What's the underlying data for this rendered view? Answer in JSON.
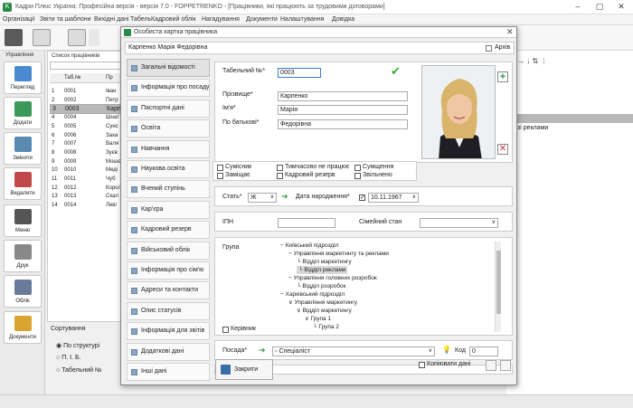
{
  "app": {
    "title": "Кадри Плюс Україна: Професійна версія - версія 7.0 - FOPPETRENKO - [Працівники, які працюють за трудовими договорами]",
    "menu": [
      "Організації",
      "Звіти та шаблони",
      "Вихідні дані",
      "Табель",
      "Кадровий облік",
      "Нагадування",
      "Документи",
      "Налаштування",
      "Довідка"
    ]
  },
  "left_panel": {
    "title": "Управління",
    "buttons": [
      "Перегляд",
      "Додати",
      "Змінити",
      "Видалити",
      "Меню",
      "Друк",
      "Облік",
      "Документи"
    ]
  },
  "list_panel": {
    "title": "Список працівників",
    "column_tab": "Таб.№",
    "column_name": "Пр",
    "rows": [
      {
        "n": "1",
        "tab": "0001",
        "name": "Іван"
      },
      {
        "n": "2",
        "tab": "0002",
        "name": "Петр"
      },
      {
        "n": "3",
        "tab": "0003",
        "name": "Карп"
      },
      {
        "n": "4",
        "tab": "0004",
        "name": "Шнат"
      },
      {
        "n": "5",
        "tab": "0005",
        "name": "Сунс"
      },
      {
        "n": "6",
        "tab": "0006",
        "name": "Заха"
      },
      {
        "n": "7",
        "tab": "0007",
        "name": "Валя"
      },
      {
        "n": "8",
        "tab": "0008",
        "name": "Зуєв"
      },
      {
        "n": "9",
        "tab": "0009",
        "name": "Мошє"
      },
      {
        "n": "10",
        "tab": "0010",
        "name": "Меді"
      },
      {
        "n": "11",
        "tab": "0011",
        "name": "Чуб"
      },
      {
        "n": "12",
        "tab": "0012",
        "name": "Корол"
      },
      {
        "n": "13",
        "tab": "0013",
        "name": "Скал"
      },
      {
        "n": "14",
        "tab": "0014",
        "name": "Леві"
      }
    ]
  },
  "sort_panel": {
    "title": "Сортування",
    "options": [
      "По структурі",
      "П. І. Б.",
      "Табельний №"
    ]
  },
  "right_bg": {
    "text": "зі реклами"
  },
  "dialog": {
    "title": "Особиста картка працівника",
    "employee_name": "Карпенко Марія Федорівна",
    "archive_label": "Архів",
    "nav": [
      "Загальні відомості",
      "Інформація про посаду",
      "Паспортні дані",
      "Освіта",
      "Навчання",
      "Наукова освіта",
      "Вчений ступінь",
      "Кар'єра",
      "Кадровий резерв",
      "Військовий облік",
      "Інформація про сім'ю",
      "Адреси та контакти",
      "Опис статусів",
      "Інформація для звітів",
      "Додаткові дані",
      "Інші дані"
    ],
    "tab_number_label": "Табельний №*",
    "tab_number": "0003",
    "surname_label": "Прізвище*",
    "surname": "Карпенко",
    "firstname_label": "Ім'я*",
    "firstname": "Марія",
    "patronymic_label": "По батькові*",
    "patronymic": "Федорівна",
    "flags": [
      {
        "label": "Сумісник",
        "on": false
      },
      {
        "label": "Тимчасово не працює",
        "on": false
      },
      {
        "label": "Сумщення",
        "on": false
      },
      {
        "label": "Заміщає",
        "on": false
      },
      {
        "label": "Кадровий резерв",
        "on": false
      },
      {
        "label": "Звільнено",
        "on": false
      }
    ],
    "sex_label": "Стать*",
    "sex": "Ж",
    "birth_label": "Дата народження*",
    "birth_date": "10.11.1967",
    "ipn_label": "ІПН",
    "family_label": "Сімейний стан",
    "group_label": "Група",
    "manager_label": "Керівник",
    "tree": [
      {
        "text": "Київський підрозділ",
        "lvl": 0,
        "sym": "−"
      },
      {
        "text": "Управління маркетингу та реклами",
        "lvl": 1,
        "sym": "−"
      },
      {
        "text": "Відділ маркетингу",
        "lvl": 2,
        "sym": ""
      },
      {
        "text": "Відділ реклами",
        "lvl": 2,
        "sym": "",
        "sel": true
      },
      {
        "text": "Управління головних розробок",
        "lvl": 1,
        "sym": "−"
      },
      {
        "text": "Відділ розробок",
        "lvl": 2,
        "sym": ""
      },
      {
        "text": "Харківський підрозділ",
        "lvl": 0,
        "sym": "−"
      },
      {
        "text": "Управління маркетингу",
        "lvl": 1,
        "sym": "∨"
      },
      {
        "text": "Відділ маркетингу",
        "lvl": 2,
        "sym": "∨"
      },
      {
        "text": "Група 1",
        "lvl": 3,
        "sym": "∨"
      },
      {
        "text": "Група 2",
        "lvl": 4,
        "sym": ""
      }
    ],
    "position_label": "Посада*",
    "position": "Спеціаліст",
    "code_label": "Код",
    "code": "0",
    "close_label": "Закрити",
    "copy_label": "Копіювати дані"
  }
}
